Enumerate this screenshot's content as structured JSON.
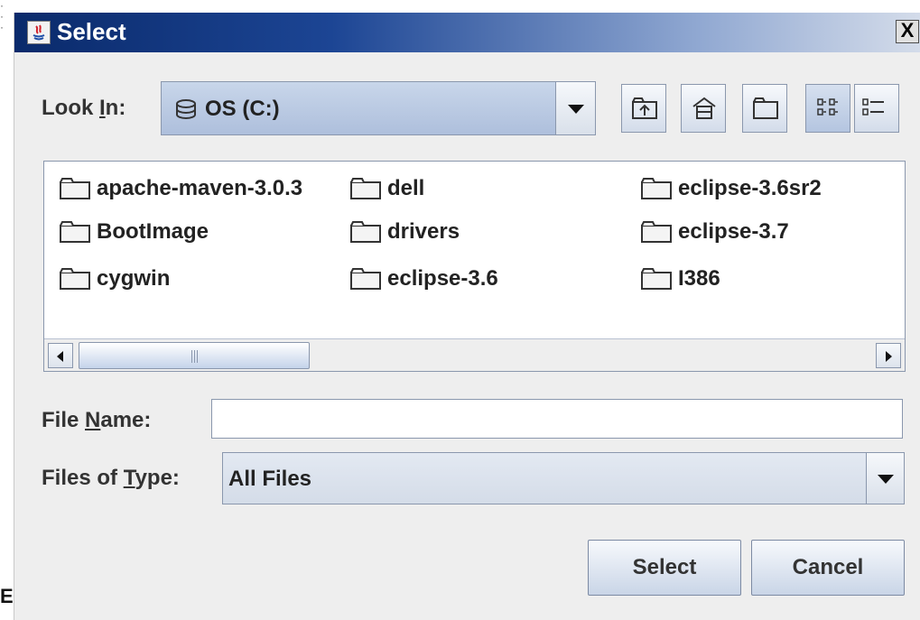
{
  "window": {
    "title": "Select",
    "close_label": "X"
  },
  "background": {
    "edge_letter": "E"
  },
  "look_in": {
    "label_pre": "Look ",
    "label_mnemonic": "I",
    "label_post": "n:",
    "value": "OS (C:)",
    "icon": "drive-icon"
  },
  "toolbar": {
    "buttons": [
      {
        "name": "up-one-level-button",
        "icon": "up-folder-icon"
      },
      {
        "name": "home-button",
        "icon": "home-icon"
      },
      {
        "name": "create-new-folder-button",
        "icon": "new-folder-icon"
      },
      {
        "name": "list-view-button",
        "icon": "list-view-icon"
      },
      {
        "name": "details-view-button",
        "icon": "details-view-icon"
      }
    ]
  },
  "files": [
    {
      "name": "apache-maven-3.0.3"
    },
    {
      "name": "BootImage"
    },
    {
      "name": "cygwin"
    },
    {
      "name": "dell"
    },
    {
      "name": "drivers"
    },
    {
      "name": "eclipse-3.6"
    },
    {
      "name": "eclipse-3.6sr2"
    },
    {
      "name": "eclipse-3.7"
    },
    {
      "name": "I386"
    }
  ],
  "file_name": {
    "label_pre": "File ",
    "label_mnemonic": "N",
    "label_post": "ame:",
    "value": ""
  },
  "files_of_type": {
    "label_pre": "Files of ",
    "label_mnemonic": "T",
    "label_post": "ype:",
    "value": "All Files"
  },
  "buttons": {
    "select": "Select",
    "cancel": "Cancel"
  },
  "colors": {
    "title_gradient_start": "#0a2a6b",
    "title_gradient_end": "#d4dcea",
    "panel_bg": "#eeeeee",
    "combo_selected_bg": "#b8c8e2"
  }
}
